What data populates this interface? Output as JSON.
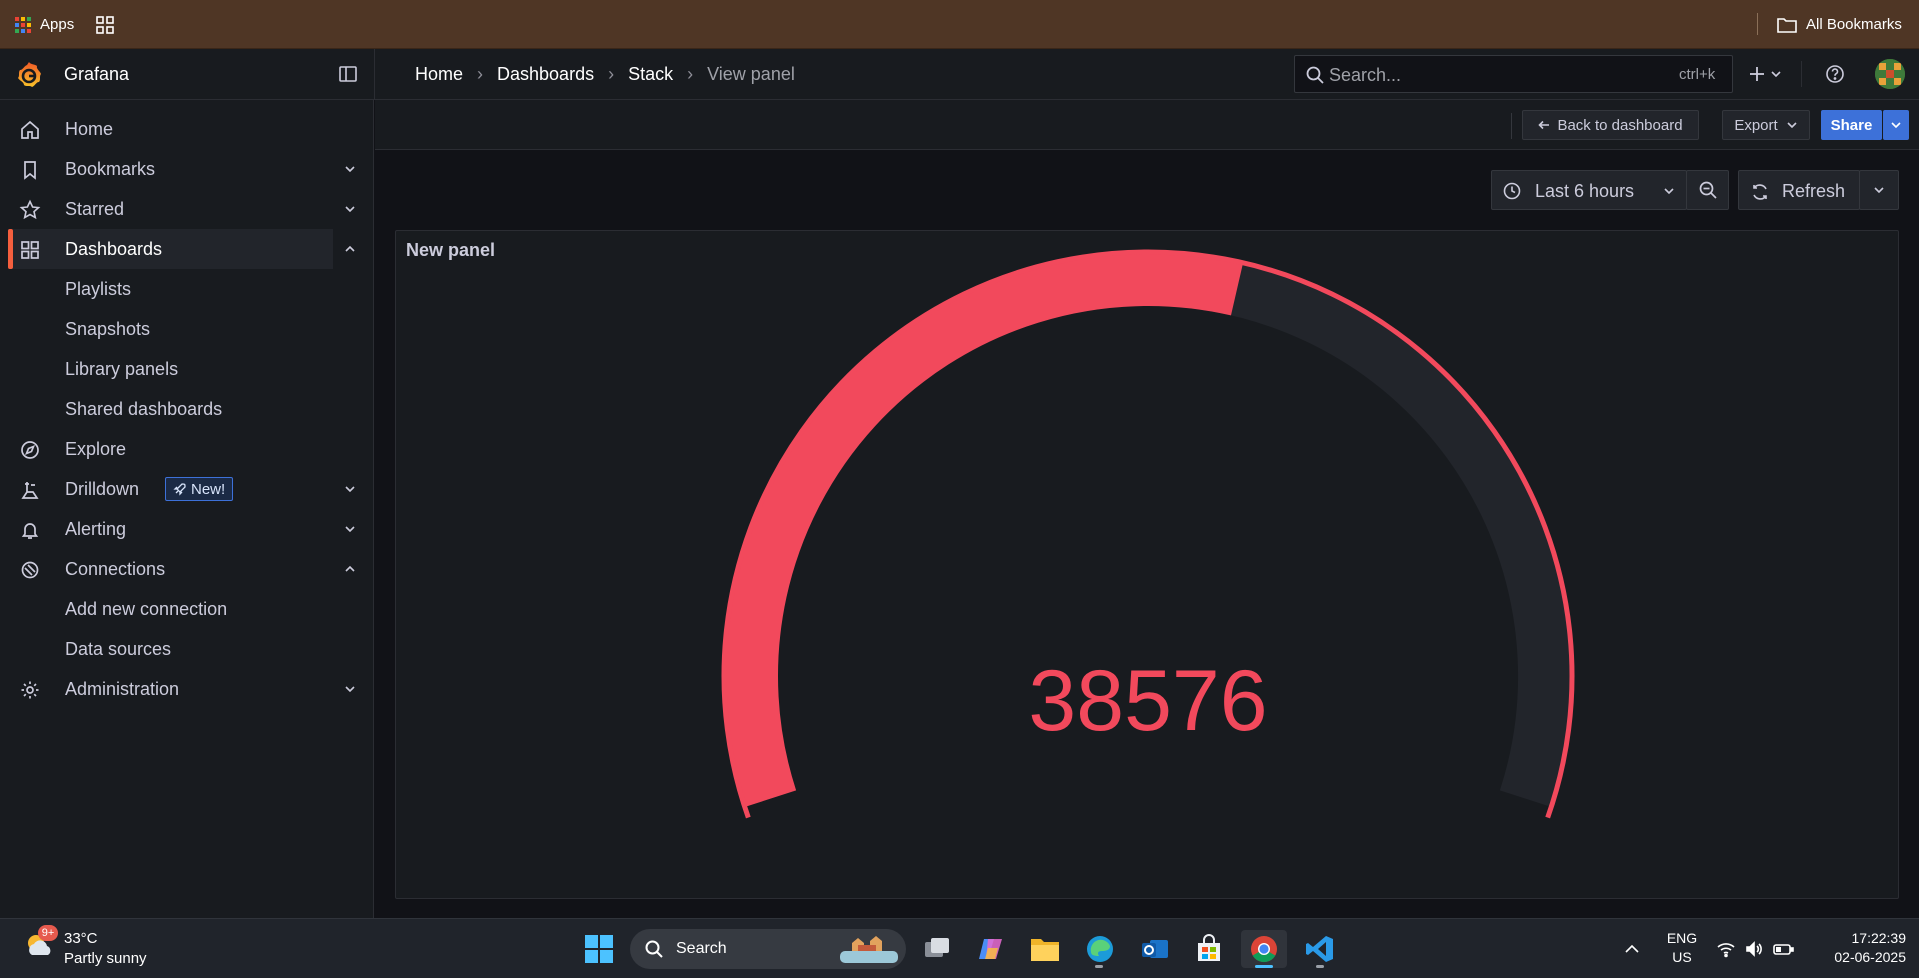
{
  "browser": {
    "apps_label": "Apps",
    "all_bookmarks_label": "All Bookmarks"
  },
  "topbar": {
    "brand": "Grafana",
    "breadcrumbs": [
      "Home",
      "Dashboards",
      "Stack",
      "View panel"
    ],
    "search_placeholder": "Search...",
    "search_shortcut": "ctrl+k"
  },
  "sidebar": {
    "items": [
      {
        "label": "Home",
        "icon": "home-icon"
      },
      {
        "label": "Bookmarks",
        "icon": "bookmark-icon",
        "chevron": "down"
      },
      {
        "label": "Starred",
        "icon": "star-icon",
        "chevron": "down"
      },
      {
        "label": "Dashboards",
        "icon": "dashboards-icon",
        "chevron": "up",
        "active": true
      },
      {
        "label": "Explore",
        "icon": "compass-icon"
      },
      {
        "label": "Drilldown",
        "icon": "drilldown-icon",
        "chevron": "down",
        "badge": "New!"
      },
      {
        "label": "Alerting",
        "icon": "bell-icon",
        "chevron": "down"
      },
      {
        "label": "Connections",
        "icon": "connections-icon",
        "chevron": "up"
      },
      {
        "label": "Administration",
        "icon": "gear-icon",
        "chevron": "down"
      }
    ],
    "dashboards_children": [
      "Playlists",
      "Snapshots",
      "Library panels",
      "Shared dashboards"
    ],
    "connections_children": [
      "Add new connection",
      "Data sources"
    ]
  },
  "actions": {
    "back_label": "Back to dashboard",
    "export_label": "Export",
    "share_label": "Share"
  },
  "toolbar": {
    "time_range": "Last 6 hours",
    "refresh_label": "Refresh"
  },
  "panel": {
    "title": "New panel",
    "value": "38576",
    "gauge_fill_fraction": 0.56,
    "color_value": "#f2495c",
    "color_track": "#22252b"
  },
  "taskbar": {
    "weather_temp": "33°C",
    "weather_desc": "Partly sunny",
    "weather_badge": "9+",
    "search_label": "Search",
    "lang_top": "ENG",
    "lang_bottom": "US",
    "time": "17:22:39",
    "date": "02-06-2025"
  }
}
